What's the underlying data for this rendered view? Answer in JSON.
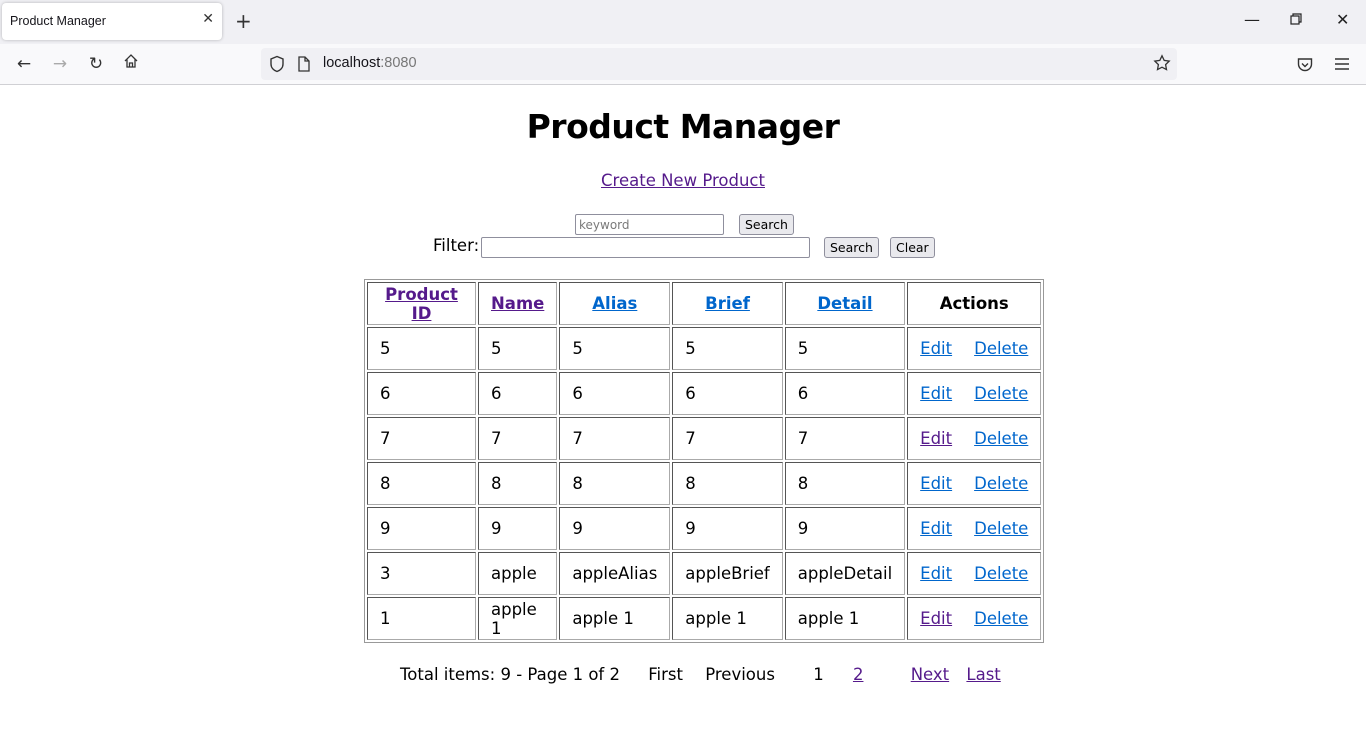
{
  "browser": {
    "tab_title": "Product Manager",
    "url_host": "localhost",
    "url_port": ":8080",
    "icons": [
      "back-icon",
      "forward-icon",
      "reload-icon",
      "home-icon",
      "shield-icon",
      "page-icon",
      "star-icon",
      "pocket-icon",
      "menu-icon",
      "minimize-icon",
      "restore-icon",
      "close-icon"
    ]
  },
  "page": {
    "title": "Product Manager",
    "create_link": "Create New Product",
    "keyword_placeholder": "keyword",
    "keyword_value": "",
    "keyword_search_label": "Search",
    "filter_label": "Filter:",
    "filter_value": "",
    "filter_search_label": "Search",
    "clear_label": "Clear"
  },
  "table": {
    "headers": [
      {
        "label": "Product ID",
        "link": true,
        "visited": true
      },
      {
        "label": "Name",
        "link": true,
        "visited": true
      },
      {
        "label": "Alias",
        "link": true,
        "visited": false
      },
      {
        "label": "Brief",
        "link": true,
        "visited": false
      },
      {
        "label": "Detail",
        "link": true,
        "visited": false
      },
      {
        "label": "Actions",
        "link": false,
        "visited": false
      }
    ],
    "edit_label": "Edit",
    "delete_label": "Delete",
    "rows": [
      {
        "id": "5",
        "name": "5",
        "alias": "5",
        "brief": "5",
        "detail": "5",
        "edit_visited": false
      },
      {
        "id": "6",
        "name": "6",
        "alias": "6",
        "brief": "6",
        "detail": "6",
        "edit_visited": false
      },
      {
        "id": "7",
        "name": "7",
        "alias": "7",
        "brief": "7",
        "detail": "7",
        "edit_visited": true
      },
      {
        "id": "8",
        "name": "8",
        "alias": "8",
        "brief": "8",
        "detail": "8",
        "edit_visited": false
      },
      {
        "id": "9",
        "name": "9",
        "alias": "9",
        "brief": "9",
        "detail": "9",
        "edit_visited": false
      },
      {
        "id": "3",
        "name": "apple",
        "alias": "appleAlias",
        "brief": "appleBrief",
        "detail": "appleDetail",
        "edit_visited": false
      },
      {
        "id": "1",
        "name": "apple 1",
        "alias": "apple 1",
        "brief": "apple 1",
        "detail": "apple 1",
        "edit_visited": true
      }
    ]
  },
  "pagination": {
    "summary": "Total items: 9 - Page 1 of 2",
    "first": "First",
    "previous": "Previous",
    "pages": [
      "1",
      "2"
    ],
    "current_page": "1",
    "next": "Next",
    "last": "Last"
  },
  "colors": {
    "link": "#0066cc",
    "visited_link": "#551a8b"
  }
}
